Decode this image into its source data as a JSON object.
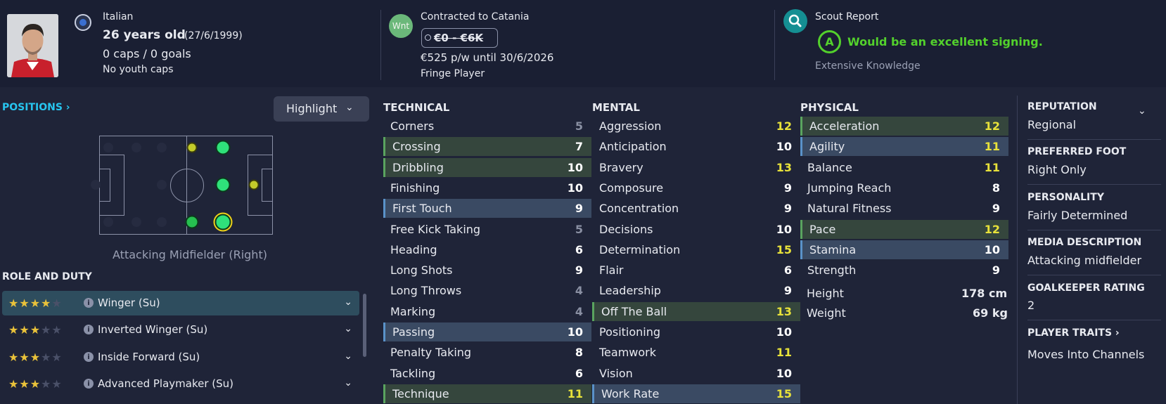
{
  "header": {
    "nationality": "Italian",
    "age_main": "26 years old",
    "age_dob": "(27/6/1999)",
    "caps": "0 caps / 0 goals",
    "youth_caps": "No youth caps",
    "wnt_badge": "Wnt",
    "contract_title": "Contracted to Catania",
    "wage_range": "€0 - €6K",
    "wage_detail": "€525 p/w until 30/6/2026",
    "squad_status": "Fringe Player",
    "scout_title": "Scout Report",
    "scout_grade": "A",
    "scout_verdict": "Would be an excellent signing.",
    "scout_knowledge": "Extensive Knowledge"
  },
  "positions": {
    "title": "POSITIONS",
    "highlight_label": "Highlight",
    "selected_position": "Attacking Midfielder (Right)"
  },
  "roles": {
    "title": "ROLE AND DUTY",
    "items": [
      {
        "name": "Winger (Su)",
        "stars": 4
      },
      {
        "name": "Inverted Winger (Su)",
        "stars": 3
      },
      {
        "name": "Inside Forward (Su)",
        "stars": 3
      },
      {
        "name": "Advanced Playmaker (Su)",
        "stars": 3
      }
    ]
  },
  "technical": {
    "title": "TECHNICAL",
    "attrs": [
      {
        "name": "Corners",
        "value": "5"
      },
      {
        "name": "Crossing",
        "value": "7"
      },
      {
        "name": "Dribbling",
        "value": "10"
      },
      {
        "name": "Finishing",
        "value": "10"
      },
      {
        "name": "First Touch",
        "value": "9"
      },
      {
        "name": "Free Kick Taking",
        "value": "5"
      },
      {
        "name": "Heading",
        "value": "6"
      },
      {
        "name": "Long Shots",
        "value": "9"
      },
      {
        "name": "Long Throws",
        "value": "4"
      },
      {
        "name": "Marking",
        "value": "4"
      },
      {
        "name": "Passing",
        "value": "10"
      },
      {
        "name": "Penalty Taking",
        "value": "8"
      },
      {
        "name": "Tackling",
        "value": "6"
      },
      {
        "name": "Technique",
        "value": "11"
      }
    ]
  },
  "mental": {
    "title": "MENTAL",
    "attrs": [
      {
        "name": "Aggression",
        "value": "12"
      },
      {
        "name": "Anticipation",
        "value": "10"
      },
      {
        "name": "Bravery",
        "value": "13"
      },
      {
        "name": "Composure",
        "value": "9"
      },
      {
        "name": "Concentration",
        "value": "9"
      },
      {
        "name": "Decisions",
        "value": "10"
      },
      {
        "name": "Determination",
        "value": "15"
      },
      {
        "name": "Flair",
        "value": "6"
      },
      {
        "name": "Leadership",
        "value": "9"
      },
      {
        "name": "Off The Ball",
        "value": "13"
      },
      {
        "name": "Positioning",
        "value": "10"
      },
      {
        "name": "Teamwork",
        "value": "11"
      },
      {
        "name": "Vision",
        "value": "10"
      },
      {
        "name": "Work Rate",
        "value": "15"
      }
    ]
  },
  "physical": {
    "title": "PHYSICAL",
    "attrs": [
      {
        "name": "Acceleration",
        "value": "12"
      },
      {
        "name": "Agility",
        "value": "11"
      },
      {
        "name": "Balance",
        "value": "11"
      },
      {
        "name": "Jumping Reach",
        "value": "8"
      },
      {
        "name": "Natural Fitness",
        "value": "9"
      },
      {
        "name": "Pace",
        "value": "12"
      },
      {
        "name": "Stamina",
        "value": "10"
      },
      {
        "name": "Strength",
        "value": "9"
      }
    ],
    "height_label": "Height",
    "height_value": "178 cm",
    "weight_label": "Weight",
    "weight_value": "69 kg"
  },
  "profile": {
    "reputation_label": "REPUTATION",
    "reputation_value": "Regional",
    "foot_label": "PREFERRED FOOT",
    "foot_value": "Right Only",
    "personality_label": "PERSONALITY",
    "personality_value": "Fairly Determined",
    "media_label": "MEDIA DESCRIPTION",
    "media_value": "Attacking midfielder",
    "gk_label": "GOALKEEPER RATING",
    "gk_value": "2",
    "traits_label": "PLAYER TRAITS",
    "traits_value": "Moves Into Channels"
  }
}
